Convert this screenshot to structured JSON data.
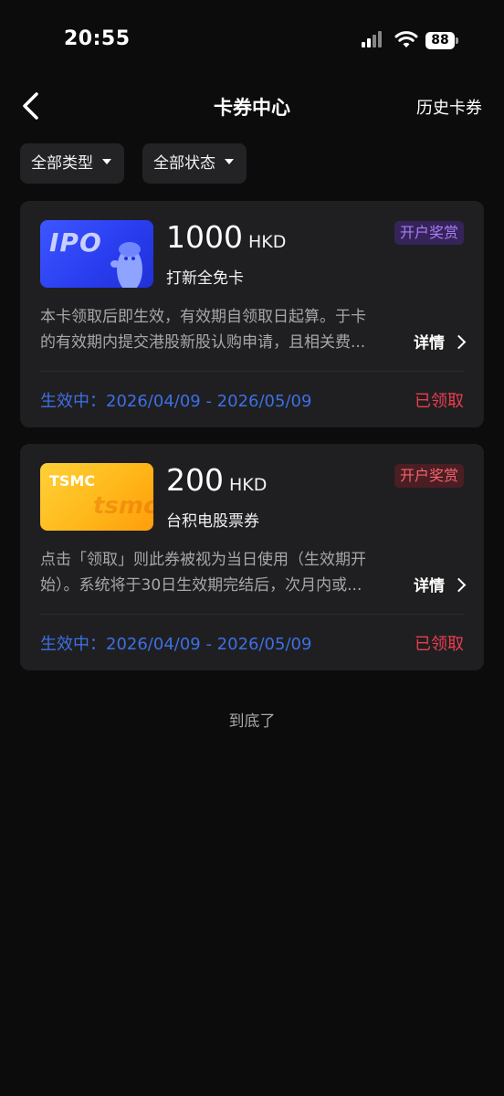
{
  "status": {
    "time": "20:55",
    "battery": "88"
  },
  "nav": {
    "title": "卡券中心",
    "history": "历史卡券"
  },
  "filters": {
    "type": "全部类型",
    "state": "全部状态"
  },
  "coupons": [
    {
      "thumb_label": "IPO",
      "amount": "1000",
      "currency": "HKD",
      "name": "打新全免卡",
      "badge": "开户奖赏",
      "desc_line1": "本卡领取后即生效，有效期自领取日起算。于卡",
      "desc_line2": "的有效期内提交港股新股认购申请，且相关费...",
      "details": "详情",
      "validity": "生效中：2026/04/09 - 2026/05/09",
      "status": "已领取"
    },
    {
      "thumb_label": "TSMC",
      "thumb_watermark": "tsmc",
      "amount": "200",
      "currency": "HKD",
      "name": "台积电股票券",
      "badge": "开户奖赏",
      "desc_line1": "点击「领取」则此券被视为当日使用（生效期开",
      "desc_line2": "始）。系统将于30日生效期完结后，次月内或...",
      "details": "详情",
      "validity": "生效中：2026/04/09 - 2026/05/09",
      "status": "已领取"
    }
  ],
  "footer": {
    "end_text": "到底了"
  },
  "colors": {
    "background": "#0c0c0d",
    "card": "#1f1f21",
    "accent_blue": "#3e6fe3",
    "claimed_red": "#ea3d50",
    "badge_purple": "#a97cf4"
  }
}
